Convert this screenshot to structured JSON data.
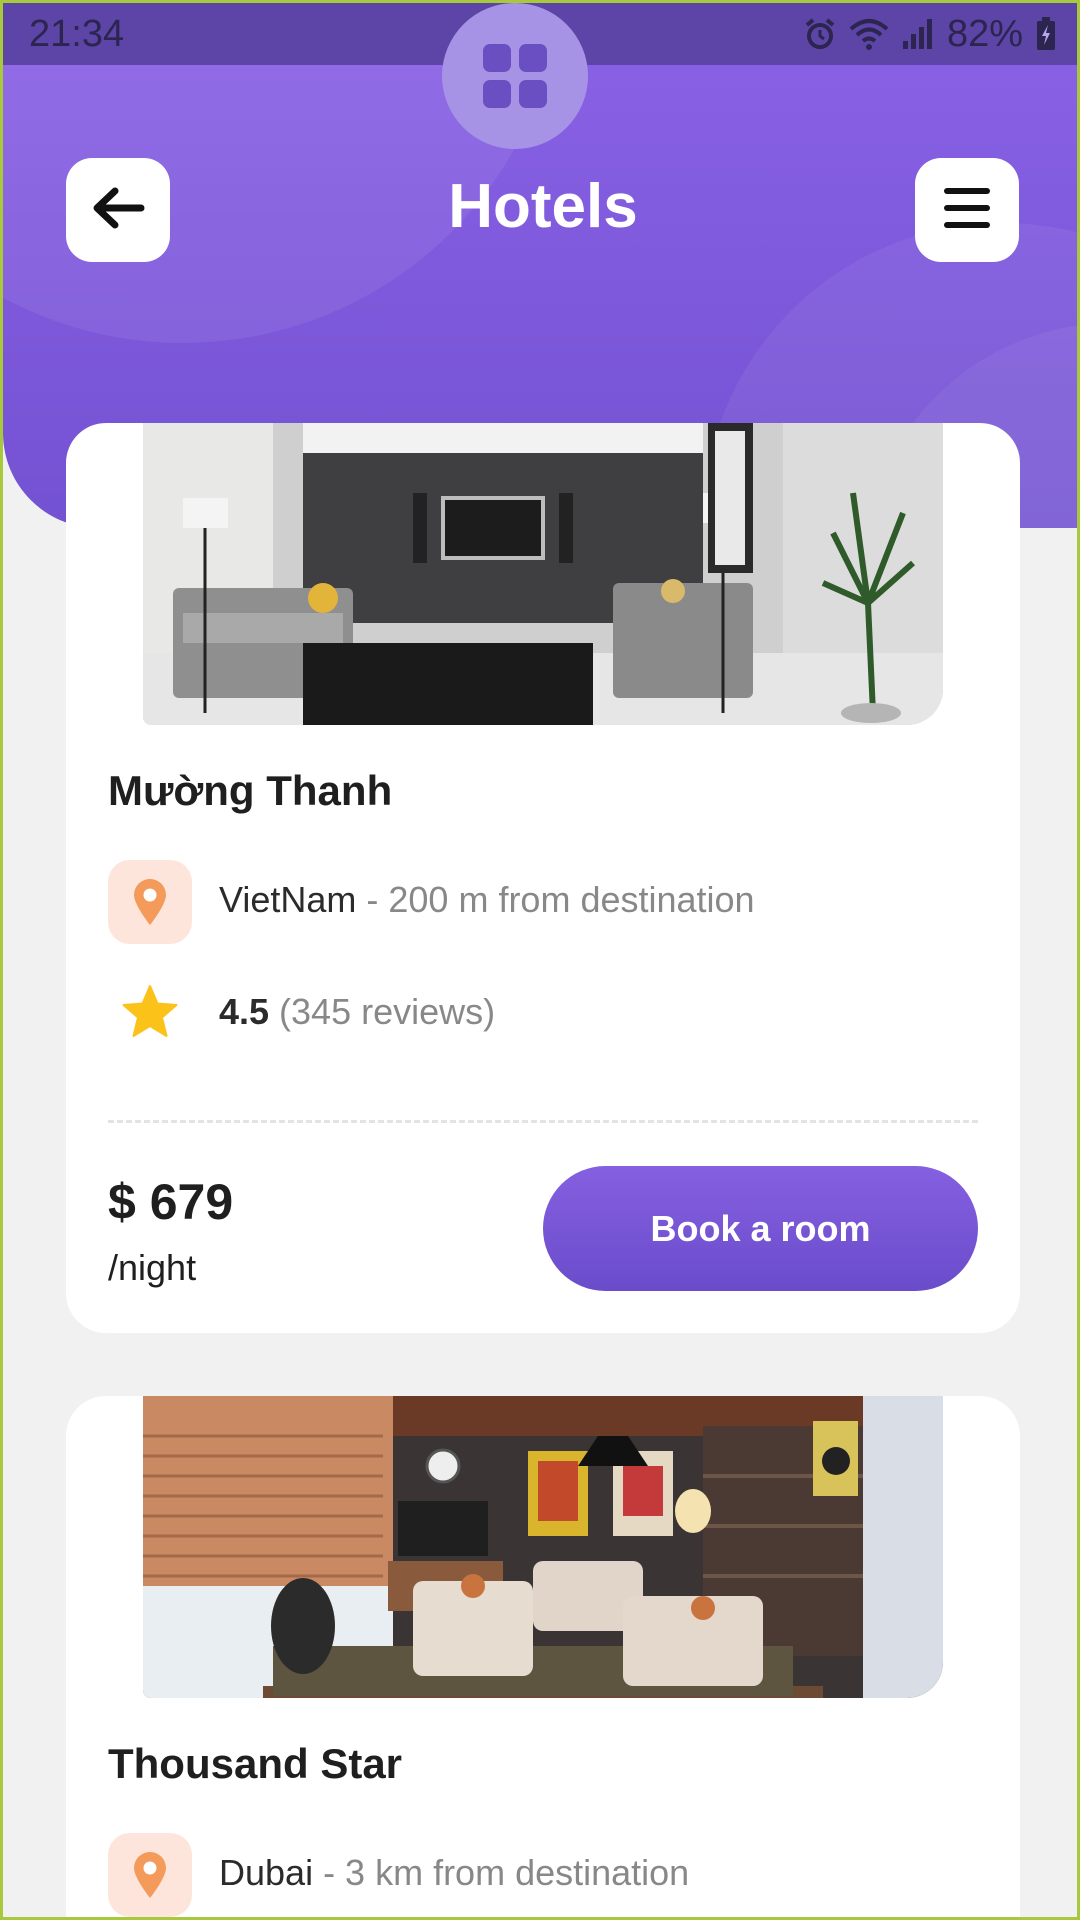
{
  "status_bar": {
    "time": "21:34",
    "battery": "82%",
    "icons": [
      "alarm-icon",
      "wifi-icon",
      "signal-icon",
      "battery-charging-icon"
    ]
  },
  "header": {
    "title": "Hotels",
    "back_icon": "arrow-left-icon",
    "menu_icon": "hamburger-menu-icon",
    "fab_icon": "grid-icon",
    "accent_color": "#7b58dc"
  },
  "hotels": [
    {
      "name": "Mường Thanh",
      "location": "VietNam",
      "distance": " - 200 m from destination",
      "rating": "4.5",
      "reviews": " (345 reviews)",
      "price": "$ 679",
      "per": "/night",
      "button": "Book a room",
      "photo": "modern gray living room with TV"
    },
    {
      "name": "Thousand Star",
      "location": "Dubai",
      "distance": " - 3 km from destination",
      "photo": "warm living room with paintings"
    }
  ]
}
